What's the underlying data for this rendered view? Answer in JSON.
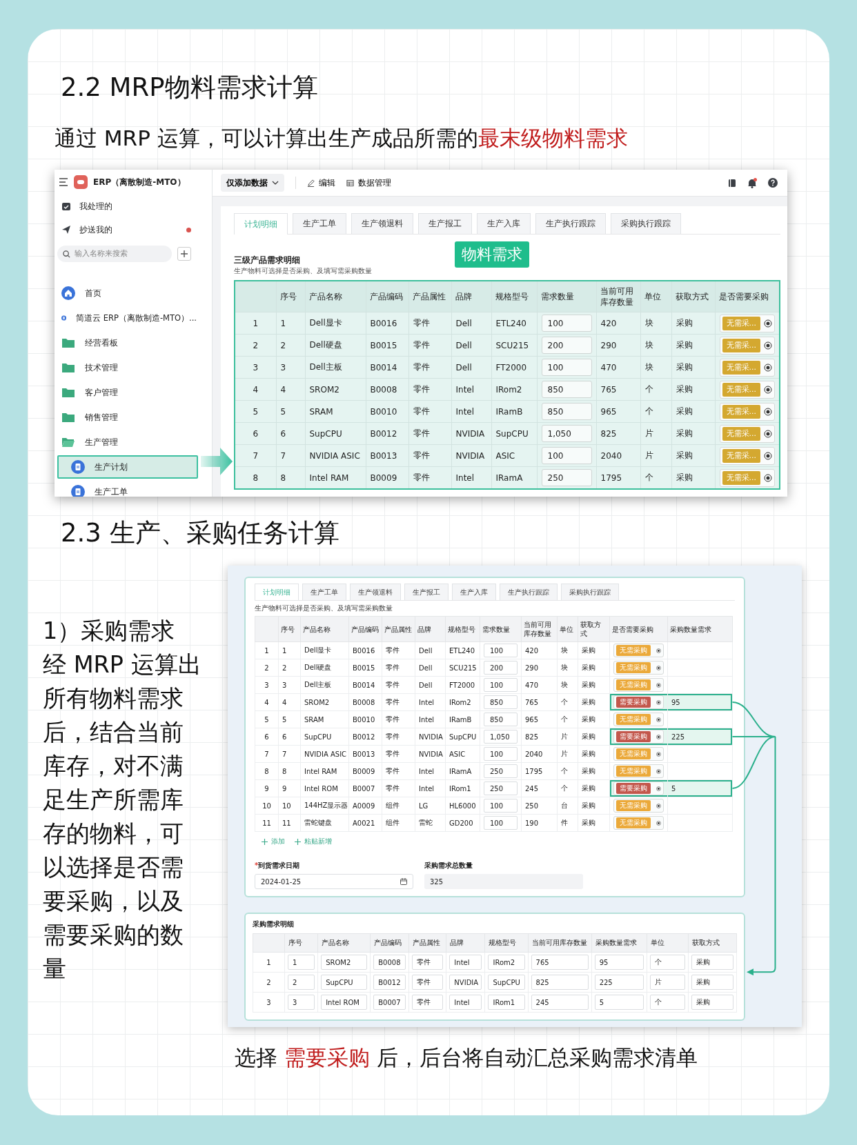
{
  "section_1": {
    "heading": "2.2 MRP物料需求计算",
    "subtitle": "通过 MRP 运算，可以计算出生产成品所需的**最末级物料需求**"
  },
  "app_1": {
    "app_title": "ERP（离散制造-MTO）",
    "sidebar": {
      "shortcuts": [
        {
          "label": "我处理的",
          "kind": "tray",
          "unread": false
        },
        {
          "label": "抄送我的",
          "kind": "send",
          "unread": true
        }
      ],
      "search": {
        "placeholder": "输入名称来搜索"
      },
      "nav": [
        {
          "label": "首页",
          "kind": "home",
          "selected": false
        },
        {
          "label": "简道云 ERP（离散制造-MTO）...",
          "kind": "app",
          "selected": false
        },
        {
          "label": "经营看板",
          "kind": "folder",
          "selected": false
        },
        {
          "label": "技术管理",
          "kind": "folder",
          "selected": false
        },
        {
          "label": "客户管理",
          "kind": "folder",
          "selected": false
        },
        {
          "label": "销售管理",
          "kind": "folder",
          "selected": false
        },
        {
          "label": "生产管理",
          "kind": "folder",
          "selected": false,
          "children": [
            {
              "label": "生产计划",
              "kind": "form",
              "selected": true
            },
            {
              "label": "生产工单",
              "kind": "form",
              "selected": false
            }
          ]
        }
      ]
    },
    "toolbar": {
      "mode_dropdown": "仅添加数据",
      "actions": [
        {
          "label": "编辑",
          "kind": "edit"
        },
        {
          "label": "数据管理",
          "kind": "table"
        }
      ],
      "notification_unread": true
    },
    "tabs": [
      {
        "label": "计划明细",
        "selected": true
      },
      {
        "label": "生产工单",
        "selected": false
      },
      {
        "label": "生产领退料",
        "selected": false
      },
      {
        "label": "生产报工",
        "selected": false
      },
      {
        "label": "生产入库",
        "selected": false
      },
      {
        "label": "生产执行跟踪",
        "selected": false
      },
      {
        "label": "采购执行跟踪",
        "selected": false
      }
    ],
    "section_title": "三级产品需求明细",
    "hint": "生产物料可选择是否采购、及填写需采购数量",
    "callout": "物料需求",
    "table": {
      "columns": [
        "序号",
        "产品名称",
        "产品编码",
        "产品属性",
        "品牌",
        "规格型号",
        "需求数量",
        "当前可用库存数量",
        "单位",
        "获取方式",
        "是否需要采购"
      ],
      "rows": [
        {
          "index": "1",
          "seq": "1",
          "name": "Dell显卡",
          "code": "B0016",
          "attribute": "零件",
          "brand": "Dell",
          "model": "ETL240",
          "demand": "100",
          "stock": "420",
          "unit": "块",
          "method": "采购",
          "purchase_tag": "无需采...",
          "purchase_needed": false
        },
        {
          "index": "2",
          "seq": "2",
          "name": "Dell硬盘",
          "code": "B0015",
          "attribute": "零件",
          "brand": "Dell",
          "model": "SCU215",
          "demand": "200",
          "stock": "290",
          "unit": "块",
          "method": "采购",
          "purchase_tag": "无需采...",
          "purchase_needed": false
        },
        {
          "index": "3",
          "seq": "3",
          "name": "Dell主板",
          "code": "B0014",
          "attribute": "零件",
          "brand": "Dell",
          "model": "FT2000",
          "demand": "100",
          "stock": "470",
          "unit": "块",
          "method": "采购",
          "purchase_tag": "无需采...",
          "purchase_needed": false
        },
        {
          "index": "4",
          "seq": "4",
          "name": "SROM2",
          "code": "B0008",
          "attribute": "零件",
          "brand": "Intel",
          "model": "IRom2",
          "demand": "850",
          "stock": "765",
          "unit": "个",
          "method": "采购",
          "purchase_tag": "无需采...",
          "purchase_needed": false
        },
        {
          "index": "5",
          "seq": "5",
          "name": "SRAM",
          "code": "B0010",
          "attribute": "零件",
          "brand": "Intel",
          "model": "IRamB",
          "demand": "850",
          "stock": "965",
          "unit": "个",
          "method": "采购",
          "purchase_tag": "无需采...",
          "purchase_needed": false
        },
        {
          "index": "6",
          "seq": "6",
          "name": "SupCPU",
          "code": "B0012",
          "attribute": "零件",
          "brand": "NVIDIA",
          "model": "SupCPU",
          "demand": "1,050",
          "stock": "825",
          "unit": "片",
          "method": "采购",
          "purchase_tag": "无需采...",
          "purchase_needed": false
        },
        {
          "index": "7",
          "seq": "7",
          "name": "NVIDIA ASIC",
          "code": "B0013",
          "attribute": "零件",
          "brand": "NVIDIA",
          "model": "ASIC",
          "demand": "100",
          "stock": "2040",
          "unit": "片",
          "method": "采购",
          "purchase_tag": "无需采...",
          "purchase_needed": false
        },
        {
          "index": "8",
          "seq": "8",
          "name": "Intel RAM",
          "code": "B0009",
          "attribute": "零件",
          "brand": "Intel",
          "model": "IRamA",
          "demand": "250",
          "stock": "1795",
          "unit": "个",
          "method": "采购",
          "purchase_tag": "无需采...",
          "purchase_needed": false
        }
      ]
    }
  },
  "section_2": {
    "heading": "2.3 生产、采购任务计算",
    "note_title": "1）采购需求",
    "note_body": "经 MRP 运算出所有物料需求后，结合当前库存，对不满足生产所需库存的物料，可以选择是否需要采购，以及需要采购的数量"
  },
  "app_2": {
    "tabs": [
      {
        "label": "计划明细",
        "selected": true
      },
      {
        "label": "生产工单",
        "selected": false
      },
      {
        "label": "生产领退料",
        "selected": false
      },
      {
        "label": "生产报工",
        "selected": false
      },
      {
        "label": "生产入库",
        "selected": false
      },
      {
        "label": "生产执行跟踪",
        "selected": false
      },
      {
        "label": "采购执行跟踪",
        "selected": false
      }
    ],
    "hint": "生产物料可选择是否采购、及填写需采购数量",
    "table": {
      "columns": [
        "序号",
        "产品名称",
        "产品编码",
        "产品属性",
        "品牌",
        "规格型号",
        "需求数量",
        "当前可用库存数量",
        "单位",
        "获取方式",
        "是否需要采购",
        "采购数量需求"
      ],
      "rows": [
        {
          "index": "1",
          "seq": "1",
          "name": "Dell显卡",
          "code": "B0016",
          "attribute": "零件",
          "brand": "Dell",
          "model": "ETL240",
          "demand": "100",
          "stock": "420",
          "unit": "块",
          "method": "采购",
          "purchase_tag": "无需采购",
          "purchase_needed": false
        },
        {
          "index": "2",
          "seq": "2",
          "name": "Dell硬盘",
          "code": "B0015",
          "attribute": "零件",
          "brand": "Dell",
          "model": "SCU215",
          "demand": "200",
          "stock": "290",
          "unit": "块",
          "method": "采购",
          "purchase_tag": "无需采购",
          "purchase_needed": false
        },
        {
          "index": "3",
          "seq": "3",
          "name": "Dell主板",
          "code": "B0014",
          "attribute": "零件",
          "brand": "Dell",
          "model": "FT2000",
          "demand": "100",
          "stock": "470",
          "unit": "块",
          "method": "采购",
          "purchase_tag": "无需采购",
          "purchase_needed": false
        },
        {
          "index": "4",
          "seq": "4",
          "name": "SROM2",
          "code": "B0008",
          "attribute": "零件",
          "brand": "Intel",
          "model": "IRom2",
          "demand": "850",
          "stock": "765",
          "unit": "个",
          "method": "采购",
          "purchase_tag": "需要采购",
          "purchase_needed": true,
          "purchase_qty": "95"
        },
        {
          "index": "5",
          "seq": "5",
          "name": "SRAM",
          "code": "B0010",
          "attribute": "零件",
          "brand": "Intel",
          "model": "IRamB",
          "demand": "850",
          "stock": "965",
          "unit": "个",
          "method": "采购",
          "purchase_tag": "无需采购",
          "purchase_needed": false
        },
        {
          "index": "6",
          "seq": "6",
          "name": "SupCPU",
          "code": "B0012",
          "attribute": "零件",
          "brand": "NVIDIA",
          "model": "SupCPU",
          "demand": "1,050",
          "stock": "825",
          "unit": "片",
          "method": "采购",
          "purchase_tag": "需要采购",
          "purchase_needed": true,
          "purchase_qty": "225"
        },
        {
          "index": "7",
          "seq": "7",
          "name": "NVIDIA ASIC",
          "code": "B0013",
          "attribute": "零件",
          "brand": "NVIDIA",
          "model": "ASIC",
          "demand": "100",
          "stock": "2040",
          "unit": "片",
          "method": "采购",
          "purchase_tag": "无需采购",
          "purchase_needed": false
        },
        {
          "index": "8",
          "seq": "8",
          "name": "Intel RAM",
          "code": "B0009",
          "attribute": "零件",
          "brand": "Intel",
          "model": "IRamA",
          "demand": "250",
          "stock": "1795",
          "unit": "个",
          "method": "采购",
          "purchase_tag": "无需采购",
          "purchase_needed": false
        },
        {
          "index": "9",
          "seq": "9",
          "name": "Intel ROM",
          "code": "B0007",
          "attribute": "零件",
          "brand": "Intel",
          "model": "IRom1",
          "demand": "250",
          "stock": "245",
          "unit": "个",
          "method": "采购",
          "purchase_tag": "需要采购",
          "purchase_needed": true,
          "purchase_qty": "5"
        },
        {
          "index": "10",
          "seq": "10",
          "name": "144HZ显示器",
          "code": "A0009",
          "attribute": "组件",
          "brand": "LG",
          "model": "HL6000",
          "demand": "100",
          "stock": "250",
          "unit": "台",
          "method": "采购",
          "purchase_tag": "无需采购",
          "purchase_needed": false
        },
        {
          "index": "11",
          "seq": "11",
          "name": "雷蛇键盘",
          "code": "A0021",
          "attribute": "组件",
          "brand": "雷蛇",
          "model": "GD200",
          "demand": "100",
          "stock": "190",
          "unit": "件",
          "method": "采购",
          "purchase_tag": "无需采购",
          "purchase_needed": false
        }
      ]
    },
    "row_actions": [
      {
        "label": "添加"
      },
      {
        "label": "粘贴新增"
      }
    ],
    "fields": [
      {
        "label": "到货需求日期",
        "required_mark": "*",
        "value": "2024-01-25",
        "kind": "date"
      },
      {
        "label": "采购需求总数量",
        "value": "325",
        "kind": "readonly"
      }
    ],
    "summary": {
      "title": "采购需求明细",
      "columns": [
        "序号",
        "产品名称",
        "产品编码",
        "产品属性",
        "品牌",
        "规格型号",
        "当前可用库存数量",
        "采购数量需求",
        "单位",
        "获取方式"
      ],
      "rows": [
        {
          "index": "1",
          "seq": "1",
          "name": "SROM2",
          "code": "B0008",
          "attribute": "零件",
          "brand": "Intel",
          "model": "IRom2",
          "stock": "765",
          "qty": "95",
          "unit": "个",
          "method": "采购"
        },
        {
          "index": "2",
          "seq": "2",
          "name": "SupCPU",
          "code": "B0012",
          "attribute": "零件",
          "brand": "NVIDIA",
          "model": "SupCPU",
          "stock": "825",
          "qty": "225",
          "unit": "片",
          "method": "采购"
        },
        {
          "index": "3",
          "seq": "3",
          "name": "Intel ROM",
          "code": "B0007",
          "attribute": "零件",
          "brand": "Intel",
          "model": "IRom1",
          "stock": "245",
          "qty": "5",
          "unit": "个",
          "method": "采购"
        }
      ]
    }
  },
  "caption": "选择 **需要采购** 后，后台将自动汇总采购需求清单"
}
